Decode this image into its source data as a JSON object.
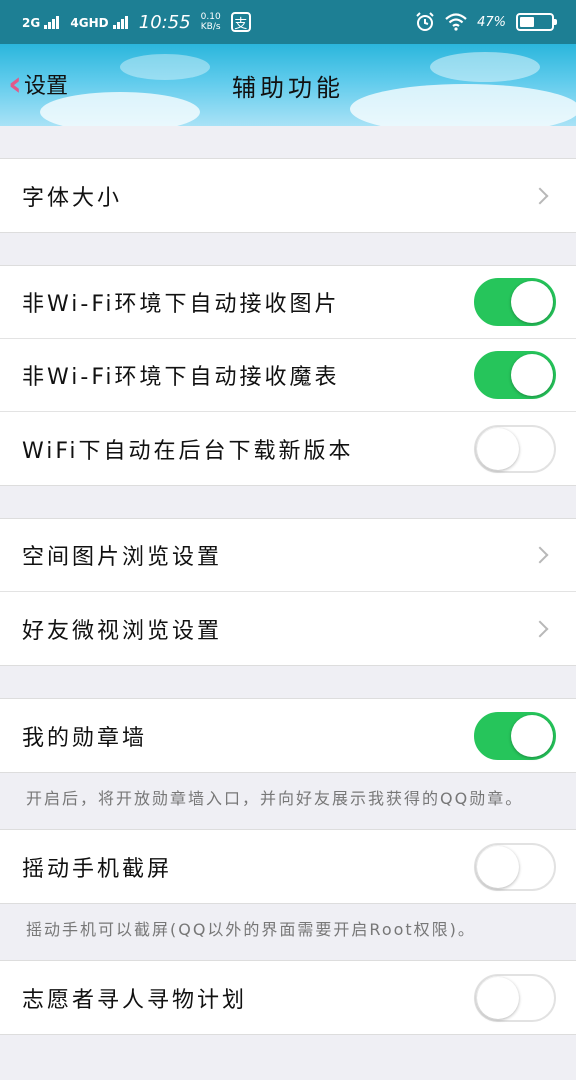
{
  "status_bar": {
    "signal1": "2G",
    "signal2": "4GHD",
    "time": "10:55",
    "net_speed_value": "0.10",
    "net_speed_unit": "KB/s",
    "alipay_icon": "支",
    "battery": "47%",
    "icons": [
      "alarm-icon",
      "wifi-icon",
      "battery-icon"
    ]
  },
  "nav": {
    "back_label": "设置",
    "title": "辅助功能"
  },
  "groups": [
    {
      "rows": [
        {
          "label": "字体大小",
          "control": "chevron"
        }
      ]
    },
    {
      "rows": [
        {
          "label": "非Wi-Fi环境下自动接收图片",
          "control": "toggle",
          "on": true
        },
        {
          "label": "非Wi-Fi环境下自动接收魔表",
          "control": "toggle",
          "on": true
        },
        {
          "label": "WiFi下自动在后台下载新版本",
          "control": "toggle",
          "on": false
        }
      ]
    },
    {
      "rows": [
        {
          "label": "空间图片浏览设置",
          "control": "chevron"
        },
        {
          "label": "好友微视浏览设置",
          "control": "chevron"
        }
      ]
    },
    {
      "rows": [
        {
          "label": "我的勋章墙",
          "control": "toggle",
          "on": true
        }
      ],
      "description": "开启后，将开放勋章墙入口，并向好友展示我获得的QQ勋章。"
    },
    {
      "rows": [
        {
          "label": "摇动手机截屏",
          "control": "toggle",
          "on": false
        }
      ],
      "description": "摇动手机可以截屏(QQ以外的界面需要开启Root权限)。"
    },
    {
      "rows": [
        {
          "label": "志愿者寻人寻物计划",
          "control": "toggle",
          "on": false
        }
      ]
    }
  ],
  "colors": {
    "status_bar": "#1d7f94",
    "toggle_on": "#26c55b",
    "back_chevron": "#e05a8a",
    "background": "#efeff4"
  }
}
